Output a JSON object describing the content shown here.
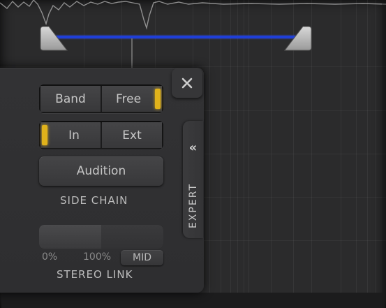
{
  "sidechain": {
    "band_label": "Band",
    "free_label": "Free",
    "in_label": "In",
    "ext_label": "Ext",
    "audition_label": "Audition",
    "section_title": "SIDE CHAIN",
    "mode_selected": "Free",
    "source_selected": "In"
  },
  "stereo_link": {
    "min_label": "0%",
    "max_label": "100%",
    "mode_label": "MID",
    "section_title": "STEREO LINK",
    "value_percent": 50
  },
  "expert": {
    "label": "EXPERT",
    "chevron": "«"
  },
  "icons": {
    "close": "close-icon",
    "chevron": "double-chevron-left-icon"
  },
  "colors": {
    "accent_led": "#e0b21b",
    "band_line": "#1f3fd8",
    "panel_bg": "#323234"
  }
}
